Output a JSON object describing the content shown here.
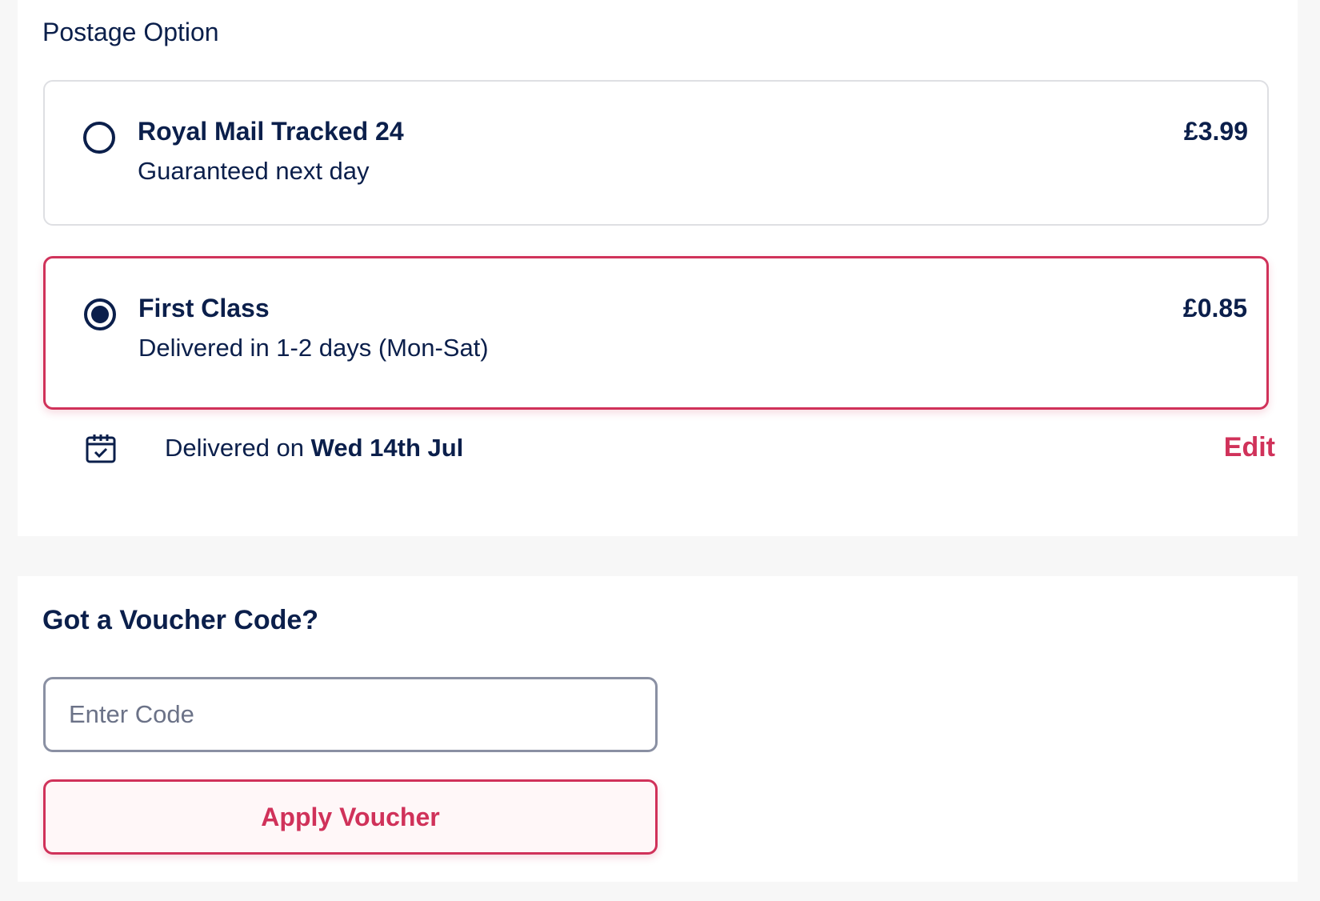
{
  "postage": {
    "section_label": "Postage Option",
    "options": [
      {
        "title": "Royal Mail Tracked 24",
        "description": "Guaranteed next day",
        "price": "£3.99",
        "selected": false
      },
      {
        "title": "First Class",
        "description": "Delivered in 1-2 days (Mon-Sat)",
        "price": "£0.85",
        "selected": true
      }
    ],
    "delivery": {
      "icon": "calendar-check-icon",
      "prefix": "Delivered on ",
      "date": "Wed 14th Jul",
      "edit_label": "Edit"
    }
  },
  "voucher": {
    "title": "Got a Voucher Code?",
    "input_placeholder": "Enter Code",
    "input_value": "",
    "apply_label": "Apply Voucher"
  },
  "colors": {
    "navy": "#0b1f4b",
    "accent": "#d0325a",
    "border": "#dedfe3",
    "page_bg": "#f7f7f7"
  }
}
